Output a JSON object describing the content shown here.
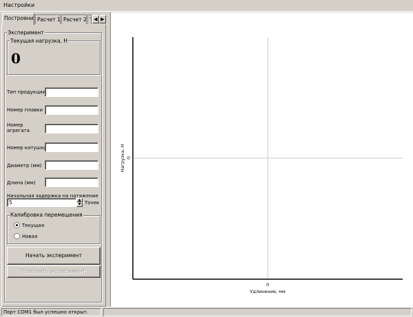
{
  "menu": {
    "settings_label": "Настройки"
  },
  "tabs": [
    {
      "label": "Построение"
    },
    {
      "label": "Расчет 1"
    },
    {
      "label": "Расчет 2"
    },
    {
      "label": "'"
    }
  ],
  "experiment": {
    "group_title": "Эксперимент",
    "load_group_title": "Текущая нагрузка, Н",
    "load_value": "0"
  },
  "form": {
    "product_type_label": "Тип продукции",
    "product_type_value": "",
    "heat_number_label": "Номер плавки",
    "heat_number_value": "",
    "unit_number_label": "Номер агрегата",
    "unit_number_value": "",
    "coil_number_label": "Номер катушки",
    "coil_number_value": "",
    "diameter_label": "Диаметр (мм)",
    "diameter_value": "",
    "length_label": "Длина (мм)",
    "length_value": "",
    "delay_label": "Начальная задержка на натяжение",
    "delay_value": "5",
    "delay_unit": "Точек"
  },
  "calibration": {
    "group_title": "Калибровка перемещения",
    "options": [
      "Текущая",
      "Новая"
    ],
    "selected": "Текущая"
  },
  "buttons": {
    "start_label": "Начать эксперимент",
    "stop_label": "Прервать эксперимент"
  },
  "chart_data": {
    "type": "line",
    "series": [],
    "xlabel": "Удлинение, мм",
    "ylabel": "Нагрузка, Н",
    "x_ticks": [
      "0"
    ],
    "y_ticks": [
      "0"
    ],
    "grid": false
  },
  "status": {
    "message": "Порт COM1 был успешно открыт."
  },
  "colors": {
    "window_bg": "#d4d0c8",
    "chart_bg": "#ffffff",
    "axis": "#000000",
    "crosshair": "#c8c8c8"
  }
}
